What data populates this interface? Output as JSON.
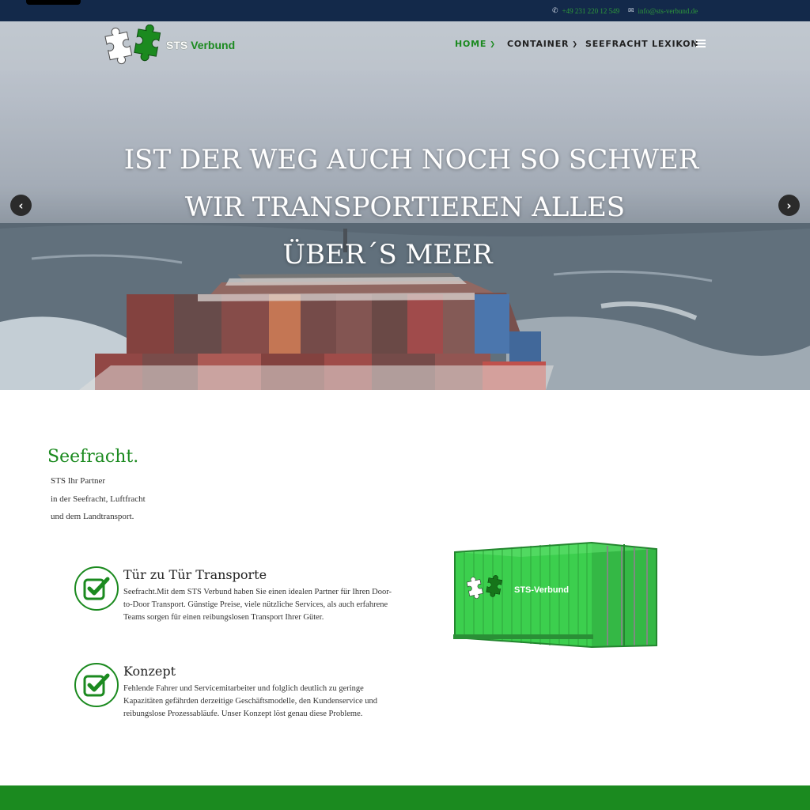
{
  "topbar": {
    "phone": "+49 231 220 12 549",
    "email": "info@sts-verbund.de",
    "phone_icon": "phone-icon",
    "email_icon": "envelope-icon"
  },
  "logo": {
    "text_part1": "STS",
    "text_part2": "Verbund"
  },
  "nav": {
    "home": "HOME",
    "container": "CONTAINER",
    "lexikon": "SEEFRACHT LEXIKON",
    "menu_icon": "hamburger-menu-icon"
  },
  "hero": {
    "line1": "IST DER WEG AUCH NOCH SO SCHWER",
    "line2": "WIR TRANSPORTIEREN ALLES",
    "line3": "ÜBER´S MEER",
    "prev_icon": "chevron-left-icon",
    "next_icon": "chevron-right-icon"
  },
  "section": {
    "title": "Seefracht.",
    "intro": [
      "STS Ihr Partner",
      "in der Seefracht, Luftfracht",
      "und dem Landtransport."
    ]
  },
  "features": [
    {
      "title": "Tür zu Tür Transporte",
      "text": "Seefracht.Mit dem STS Verbund haben Sie einen idealen Partner für Ihren Door-to-Door Transport. Günstige Preise, viele nützliche Services, als auch erfahrene Teams sorgen für einen reibungslosen Transport Ihrer Güter.",
      "icon": "checkbox-check-icon"
    },
    {
      "title": "Konzept",
      "text": "Fehlende Fahrer und Servicemitarbeiter und folglich deutlich zu geringe Kapazitäten gefährden derzeitige Geschäftsmodelle, den Kundenservice und reibungslose Prozessabläufe. Unser Konzept löst genau diese Probleme.",
      "icon": "checkbox-check-icon"
    }
  ],
  "container_label": "STS-Verbund",
  "colors": {
    "brand_green": "#1b8a1f",
    "topbar_navy": "#13294a",
    "container_green": "#3ccf4e"
  }
}
